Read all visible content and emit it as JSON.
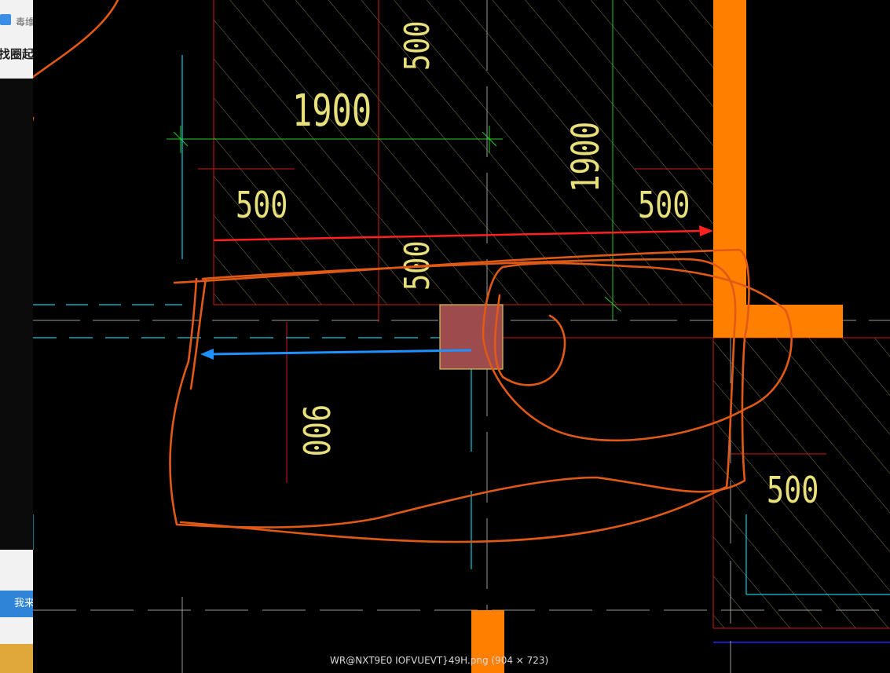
{
  "left_strip": {
    "tab_text": "毒维",
    "question_text": "找圈起",
    "button_label": "我来"
  },
  "drawing": {
    "dimensions": {
      "top_width": "1900",
      "top_height": "500",
      "mid_left": "500",
      "mid_height": "1900",
      "mid_right": "500",
      "mid_center": "500",
      "lower_height": "900",
      "lower_right": "500"
    }
  },
  "viewer": {
    "caption": "WR@NXT9E0 IOFVUEVT}49H.png (904 × 723)"
  },
  "colors": {
    "background": "#000000",
    "column": "#ff7f00",
    "annotation": "#e05a16",
    "red_arrow": "#ff2020",
    "blue_arrow": "#1e90ff",
    "dimension_text": "#e8e07a"
  }
}
